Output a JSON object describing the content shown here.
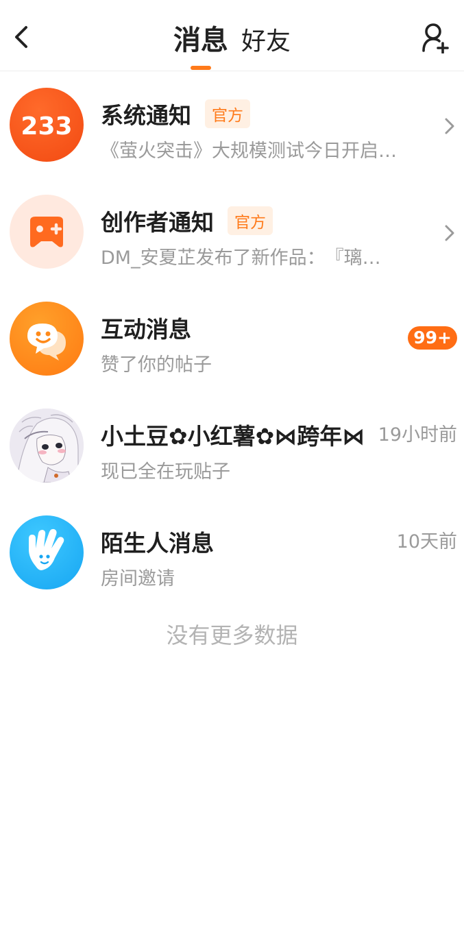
{
  "header": {
    "tab_active": "消息",
    "tab_inactive": "好友",
    "back_icon": "chevron-left-icon",
    "add_friend_icon": "user-plus-icon",
    "accent_color": "#ff7a1a"
  },
  "messages": [
    {
      "title": "系统通知",
      "badge": "官方",
      "subtitle": "《萤火突击》大规模测试今日开启…",
      "avatar_text": "233",
      "avatar_icon": "brand-233-icon"
    },
    {
      "title": "创作者通知",
      "badge": "官方",
      "subtitle": "DM_安夏芷发布了新作品：　『璃…",
      "avatar_icon": "gamepad-icon"
    },
    {
      "title": "互动消息",
      "subtitle": "赞了你的帖子",
      "count": "99+",
      "avatar_icon": "smile-chat-icon"
    },
    {
      "title": "小土豆✿小红薯✿⋈跨年⋈",
      "subtitle": "现已全在玩贴子",
      "time": "19小时前",
      "avatar_icon": "anime-girl-avatar"
    },
    {
      "title": "陌生人消息",
      "subtitle": "房间邀请",
      "time": "10天前",
      "avatar_icon": "waving-hand-icon"
    }
  ],
  "footer": {
    "no_more": "没有更多数据"
  }
}
